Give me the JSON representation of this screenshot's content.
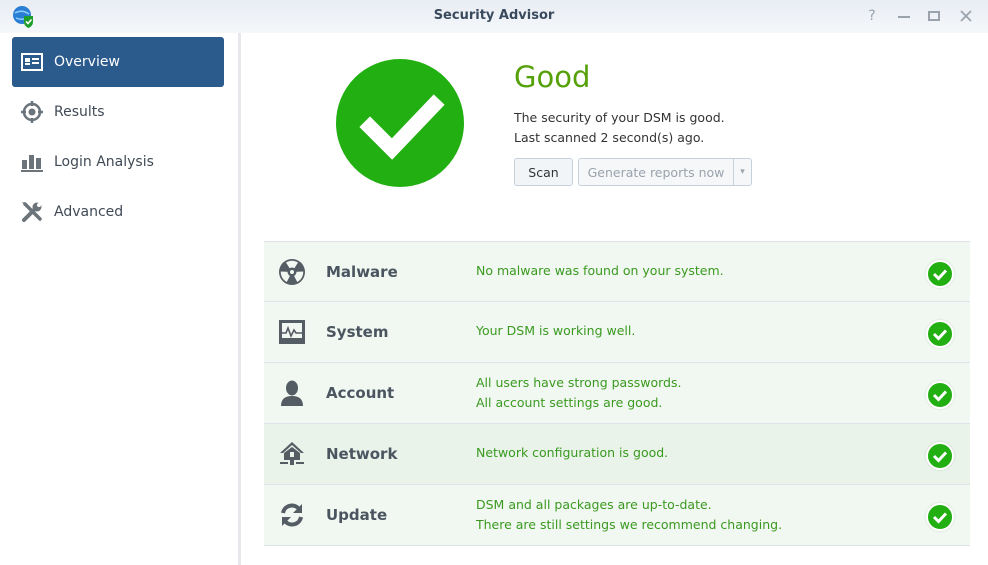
{
  "window": {
    "title": "Security Advisor",
    "controls": {
      "help": "?",
      "minimize": "—",
      "maximize": "▭",
      "close": "✕"
    }
  },
  "sidebar": {
    "items": [
      {
        "label": "Overview",
        "icon": "overview-card-icon",
        "active": true
      },
      {
        "label": "Results",
        "icon": "target-icon",
        "active": false
      },
      {
        "label": "Login Analysis",
        "icon": "bar-chart-icon",
        "active": false
      },
      {
        "label": "Advanced",
        "icon": "wrench-screwdriver-icon",
        "active": false
      }
    ]
  },
  "status": {
    "title": "Good",
    "line1": "The security of your DSM is good.",
    "line2": "Last scanned 2 second(s) ago.",
    "scan_button": "Scan",
    "report_button": "Generate reports now",
    "dropdown_glyph": "▾",
    "color": "#22af12"
  },
  "checks": [
    {
      "name": "Malware",
      "icon": "radiation-icon",
      "lines": [
        "No malware was found on your system."
      ],
      "status": "ok"
    },
    {
      "name": "System",
      "icon": "monitor-pulse-icon",
      "lines": [
        "Your DSM is working well."
      ],
      "status": "ok"
    },
    {
      "name": "Account",
      "icon": "user-icon",
      "lines": [
        "All users have strong passwords.",
        "All account settings are good."
      ],
      "status": "ok"
    },
    {
      "name": "Network",
      "icon": "network-house-icon",
      "lines": [
        "Network configuration is good."
      ],
      "status": "ok"
    },
    {
      "name": "Update",
      "icon": "refresh-icon",
      "lines": [
        "DSM and all packages are up-to-date.",
        "There are still settings we recommend changing."
      ],
      "status": "ok"
    }
  ]
}
